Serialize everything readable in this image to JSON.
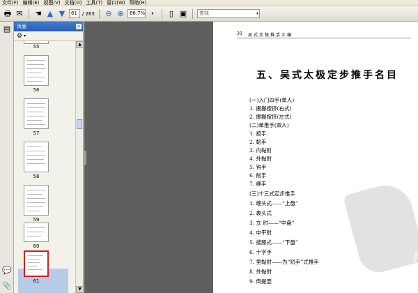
{
  "menu": [
    "文件(F)",
    "编辑(E)",
    "视图(V)",
    "文档(D)",
    "工具(T)",
    "窗口(W)",
    "帮助(H)"
  ],
  "toolbar": {
    "current_page": "61",
    "total_pages": "/ 263",
    "zoom": "66.7%",
    "search_placeholder": "查找"
  },
  "panel": {
    "title": "页面",
    "thumbnails": [
      {
        "label": "55"
      },
      {
        "label": "56"
      },
      {
        "label": "57"
      },
      {
        "label": "58"
      },
      {
        "label": "59"
      },
      {
        "label": "60"
      },
      {
        "label": "61"
      }
    ]
  },
  "document": {
    "page_number": "30",
    "running_head": "吴式太极推手汇编",
    "title": "五、吴式太极定步推手名目",
    "lines": [
      "(一)入门四手(单人)",
      "1. 掤搬按挤(右式)",
      "2. 掤搬按挤(左式)",
      "(二)单推手(双人)",
      "1. 按手",
      "2. 黏手",
      "3. 内黏肘",
      "4. 外黏肘",
      "5. 钩手",
      "6. 削手",
      "7. 缠手",
      "(三)十三式定步推手",
      "1. 缠头式——“上盘”",
      "2. 裹头式",
      "3. 立    肘——“中盘”",
      "4. 中平肘",
      "5. 搂膝式——“下盘”",
      "6. 十字手",
      "7. 里黏肘——为“短手”式推手",
      "8. 外黏肘",
      "9. 倒提壶"
    ],
    "watermark": "PDG"
  }
}
